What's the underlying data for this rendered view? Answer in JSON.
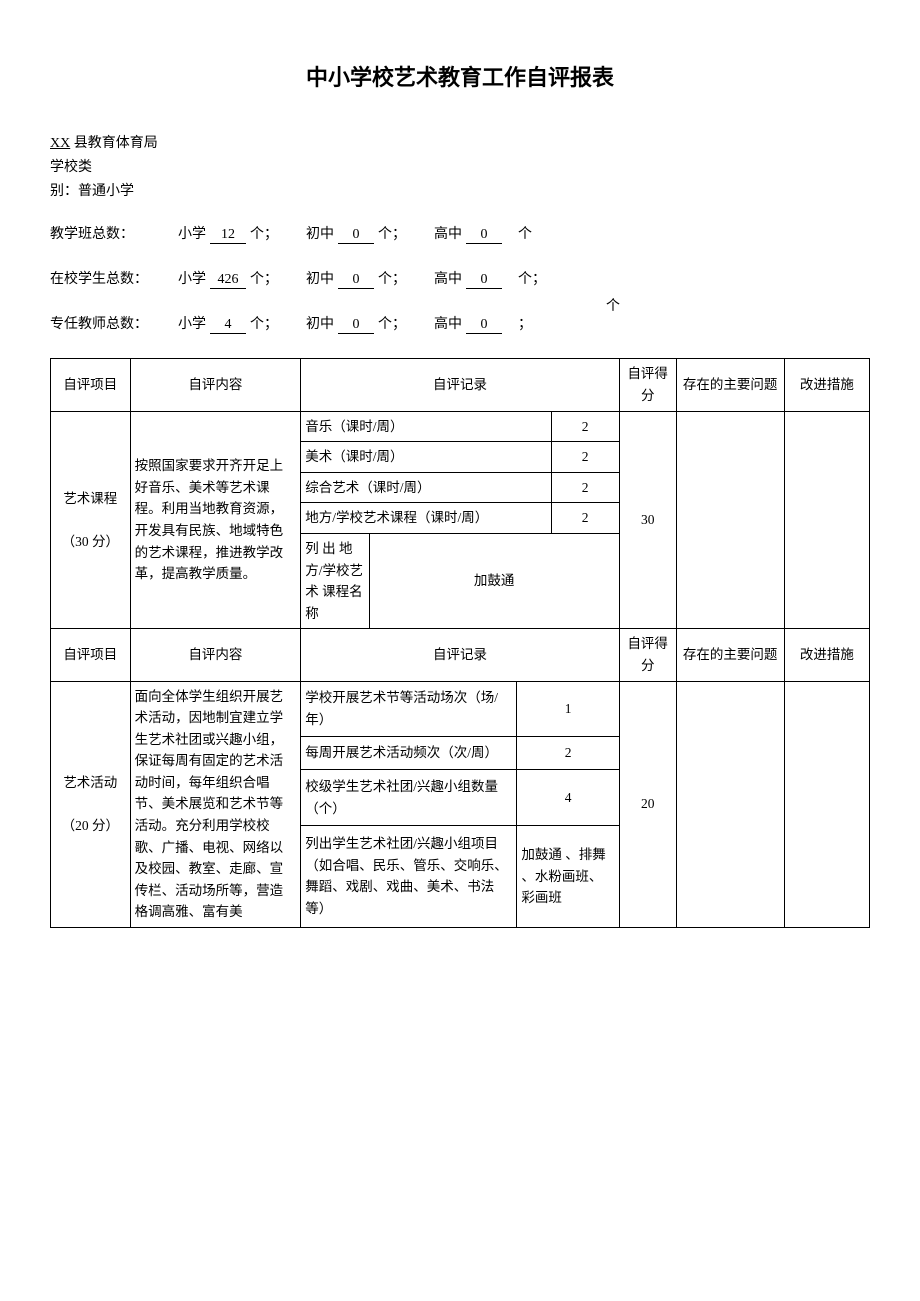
{
  "title": "中小学校艺术教育工作自评报表",
  "header": {
    "bureau_prefix": "XX",
    "bureau_suffix": " 县教育体育局",
    "school_type_label": "学校类",
    "school_type_line2_prefix": "别：",
    "school_type_value": "普通小学"
  },
  "counts": {
    "classes": {
      "label": "教学班总数：",
      "primary_label": "小学",
      "primary_value": "12",
      "unit1": "个；",
      "middle_label": "初中",
      "middle_value": "0",
      "unit2": "个；",
      "high_label": "高中",
      "high_value": "0",
      "unit3": "个"
    },
    "students": {
      "label": "在校学生总数：",
      "primary_label": "小学",
      "primary_value": "426",
      "unit1": "个；",
      "middle_label": "初中",
      "middle_value": "0",
      "unit2": "个；",
      "high_label": "高中",
      "high_value": "0",
      "unit3": "个；"
    },
    "teachers": {
      "float_ge": "个",
      "label": "专任教师总数：",
      "primary_label": "小学",
      "primary_value": "4",
      "unit1": "个；",
      "middle_label": "初中",
      "middle_value": "0",
      "unit2": "个；",
      "high_label": "高中",
      "high_value": "0",
      "unit3": "；"
    }
  },
  "table": {
    "headers": {
      "project": "自评项目",
      "content": "自评内容",
      "record": "自评记录",
      "score": "自评得分",
      "problems": "存在的主要问题",
      "measures": "改进措施"
    },
    "section1": {
      "project_name": "艺术课程",
      "project_weight": "（30 分）",
      "content": "按照国家要求开齐开足上好音乐、美术等艺术课程。利用当地教育资源，开发具有民族、地域特色的艺术课程，推进教学改革，提高教学质量。",
      "rows": [
        {
          "label": "音乐（课时/周）",
          "value": "2"
        },
        {
          "label": "美术（课时/周）",
          "value": "2"
        },
        {
          "label": "综合艺术（课时/周）",
          "value": "2"
        },
        {
          "label": "地方/学校艺术课程（课时/周）",
          "value": "2"
        }
      ],
      "list_label": "列 出 地方/学校艺 术 课程名称",
      "list_value": "加鼓通",
      "score": "30"
    },
    "section2": {
      "project_name": "艺术活动",
      "project_weight": "（20 分）",
      "content": "面向全体学生组织开展艺术活动，因地制宜建立学生艺术社团或兴趣小组，保证每周有固定的艺术活动时间，每年组织合唱节、美术展览和艺术节等活动。充分利用学校校歌、广播、电视、网络以及校园、教室、走廊、宣传栏、活动场所等，营造格调高雅、富有美",
      "rows": [
        {
          "label": "学校开展艺术节等活动场次（场/年）",
          "value": "1"
        },
        {
          "label": "每周开展艺术活动频次（次/周）",
          "value": "2"
        },
        {
          "label": "校级学生艺术社团/兴趣小组数量（个）",
          "value": "4"
        }
      ],
      "list_label": "列出学生艺术社团/兴趣小组项目（如合唱、民乐、管乐、交响乐、舞蹈、戏剧、戏曲、美术、书法等）",
      "list_value": "加鼓通 、排舞 、水粉画班、彩画班",
      "score": "20"
    }
  }
}
